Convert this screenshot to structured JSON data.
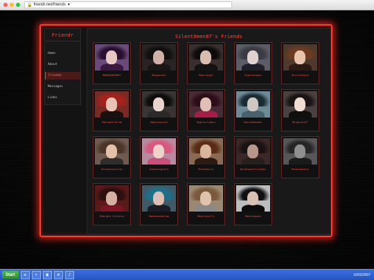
{
  "browser": {
    "url": "friendr.net/friends"
  },
  "site": {
    "name": "Friendr",
    "nav": [
      {
        "label": "Home"
      },
      {
        "label": "About"
      },
      {
        "label": "Friends"
      },
      {
        "label": "Messages"
      },
      {
        "label": "Links"
      }
    ]
  },
  "page": {
    "heading": "SilentOmen87's Friends"
  },
  "friends": [
    {
      "name": "MORBIDDREAMS1"
    },
    {
      "name": "Mangowrath"
    },
    {
      "name": "Moonlangel"
    },
    {
      "name": "Xxdarksnowxx"
    },
    {
      "name": "Mxlittlebyte"
    },
    {
      "name": "Midnightchilde"
    },
    {
      "name": "Haperaneurph"
    },
    {
      "name": "Nightsclubbin"
    },
    {
      "name": "Hauntedsmoker"
    },
    {
      "name": "Margarine77"
    },
    {
      "name": "Milesbaconities"
    },
    {
      "name": "Dionesinpierd"
    },
    {
      "name": "Mitendmiris"
    },
    {
      "name": "NoisEsweetfriendzz"
    },
    {
      "name": "Mxeaneapatia"
    },
    {
      "name": "Midnight Victoria"
    },
    {
      "name": "Madeanomeblium"
    },
    {
      "name": "Meowlitpills"
    },
    {
      "name": "Mekaleagaze"
    }
  ],
  "taskbar": {
    "start_label": "Start",
    "icons": [
      "recycle-icon",
      "notepad-icon",
      "folder-icon",
      "settings-icon",
      "speaker-icon"
    ],
    "clock": "10/02/2007"
  }
}
